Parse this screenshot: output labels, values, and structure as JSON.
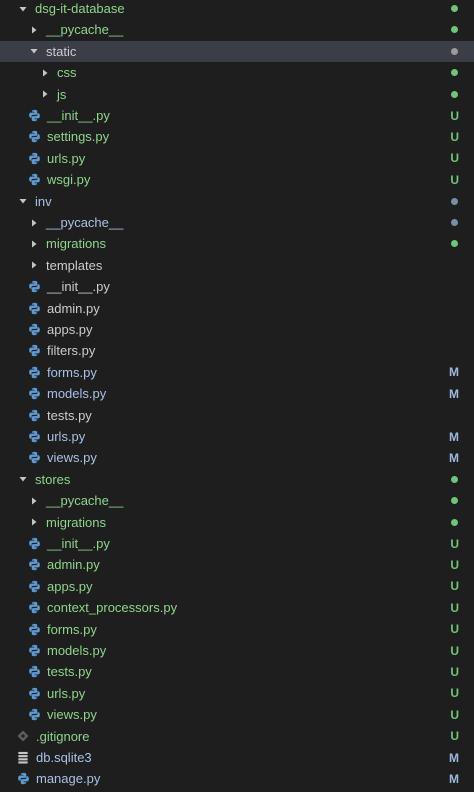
{
  "colors": {
    "background": "#1e1e1e",
    "selected_row": "#3b3e46",
    "untracked": "#73c991",
    "modified": "#e2c08d",
    "untracked_text": "#8fd48c",
    "modified_text": "#a9c1e6",
    "default_text": "#cccccc",
    "modified_badge": "#9fb8de",
    "untracked_badge": "#6fc47a",
    "folder_dot_muted": "#7a8da6",
    "python_icon": "#5d9ad1",
    "chevron": "#c5c5c5"
  },
  "explorer": {
    "items": [
      {
        "label": "dsg-it-database",
        "kind": "folder-open",
        "depth": 0,
        "status": "untracked",
        "badge": "",
        "dot": "green"
      },
      {
        "label": "__pycache__",
        "kind": "folder-closed",
        "depth": 1,
        "status": "untracked",
        "badge": "",
        "dot": "green"
      },
      {
        "label": "static",
        "kind": "folder-open",
        "depth": 1,
        "status": "default",
        "badge": "",
        "dot": "grey",
        "selected": true
      },
      {
        "label": "css",
        "kind": "folder-closed",
        "depth": 2,
        "status": "untracked",
        "badge": "",
        "dot": "green"
      },
      {
        "label": "js",
        "kind": "folder-closed",
        "depth": 2,
        "status": "untracked",
        "badge": "",
        "dot": "green"
      },
      {
        "label": "__init__.py",
        "kind": "python",
        "depth": 1,
        "status": "untracked",
        "badge": "U",
        "dot": ""
      },
      {
        "label": "settings.py",
        "kind": "python",
        "depth": 1,
        "status": "untracked",
        "badge": "U",
        "dot": ""
      },
      {
        "label": "urls.py",
        "kind": "python",
        "depth": 1,
        "status": "untracked",
        "badge": "U",
        "dot": ""
      },
      {
        "label": "wsgi.py",
        "kind": "python",
        "depth": 1,
        "status": "untracked",
        "badge": "U",
        "dot": ""
      },
      {
        "label": "inv",
        "kind": "folder-open",
        "depth": 0,
        "status": "modified",
        "badge": "",
        "dot": "blue"
      },
      {
        "label": "__pycache__",
        "kind": "folder-closed",
        "depth": 1,
        "status": "modified",
        "badge": "",
        "dot": "blue"
      },
      {
        "label": "migrations",
        "kind": "folder-closed",
        "depth": 1,
        "status": "untracked",
        "badge": "",
        "dot": "green"
      },
      {
        "label": "templates",
        "kind": "folder-closed",
        "depth": 1,
        "status": "default",
        "badge": "",
        "dot": ""
      },
      {
        "label": "__init__.py",
        "kind": "python",
        "depth": 1,
        "status": "default",
        "badge": "",
        "dot": ""
      },
      {
        "label": "admin.py",
        "kind": "python",
        "depth": 1,
        "status": "default",
        "badge": "",
        "dot": ""
      },
      {
        "label": "apps.py",
        "kind": "python",
        "depth": 1,
        "status": "default",
        "badge": "",
        "dot": ""
      },
      {
        "label": "filters.py",
        "kind": "python",
        "depth": 1,
        "status": "default",
        "badge": "",
        "dot": ""
      },
      {
        "label": "forms.py",
        "kind": "python",
        "depth": 1,
        "status": "modified",
        "badge": "M",
        "dot": ""
      },
      {
        "label": "models.py",
        "kind": "python",
        "depth": 1,
        "status": "modified",
        "badge": "M",
        "dot": ""
      },
      {
        "label": "tests.py",
        "kind": "python",
        "depth": 1,
        "status": "default",
        "badge": "",
        "dot": ""
      },
      {
        "label": "urls.py",
        "kind": "python",
        "depth": 1,
        "status": "modified",
        "badge": "M",
        "dot": ""
      },
      {
        "label": "views.py",
        "kind": "python",
        "depth": 1,
        "status": "modified",
        "badge": "M",
        "dot": ""
      },
      {
        "label": "stores",
        "kind": "folder-open",
        "depth": 0,
        "status": "untracked",
        "badge": "",
        "dot": "green"
      },
      {
        "label": "__pycache__",
        "kind": "folder-closed",
        "depth": 1,
        "status": "untracked",
        "badge": "",
        "dot": "green"
      },
      {
        "label": "migrations",
        "kind": "folder-closed",
        "depth": 1,
        "status": "untracked",
        "badge": "",
        "dot": "green"
      },
      {
        "label": "__init__.py",
        "kind": "python",
        "depth": 1,
        "status": "untracked",
        "badge": "U",
        "dot": ""
      },
      {
        "label": "admin.py",
        "kind": "python",
        "depth": 1,
        "status": "untracked",
        "badge": "U",
        "dot": ""
      },
      {
        "label": "apps.py",
        "kind": "python",
        "depth": 1,
        "status": "untracked",
        "badge": "U",
        "dot": ""
      },
      {
        "label": "context_processors.py",
        "kind": "python",
        "depth": 1,
        "status": "untracked",
        "badge": "U",
        "dot": ""
      },
      {
        "label": "forms.py",
        "kind": "python",
        "depth": 1,
        "status": "untracked",
        "badge": "U",
        "dot": ""
      },
      {
        "label": "models.py",
        "kind": "python",
        "depth": 1,
        "status": "untracked",
        "badge": "U",
        "dot": ""
      },
      {
        "label": "tests.py",
        "kind": "python",
        "depth": 1,
        "status": "untracked",
        "badge": "U",
        "dot": ""
      },
      {
        "label": "urls.py",
        "kind": "python",
        "depth": 1,
        "status": "untracked",
        "badge": "U",
        "dot": ""
      },
      {
        "label": "views.py",
        "kind": "python",
        "depth": 1,
        "status": "untracked",
        "badge": "U",
        "dot": ""
      },
      {
        "label": ".gitignore",
        "kind": "gitignore",
        "depth": 0,
        "status": "untracked",
        "badge": "U",
        "dot": ""
      },
      {
        "label": "db.sqlite3",
        "kind": "database",
        "depth": 0,
        "status": "modified",
        "badge": "M",
        "dot": ""
      },
      {
        "label": "manage.py",
        "kind": "python",
        "depth": 0,
        "status": "modified",
        "badge": "M",
        "dot": ""
      }
    ]
  }
}
